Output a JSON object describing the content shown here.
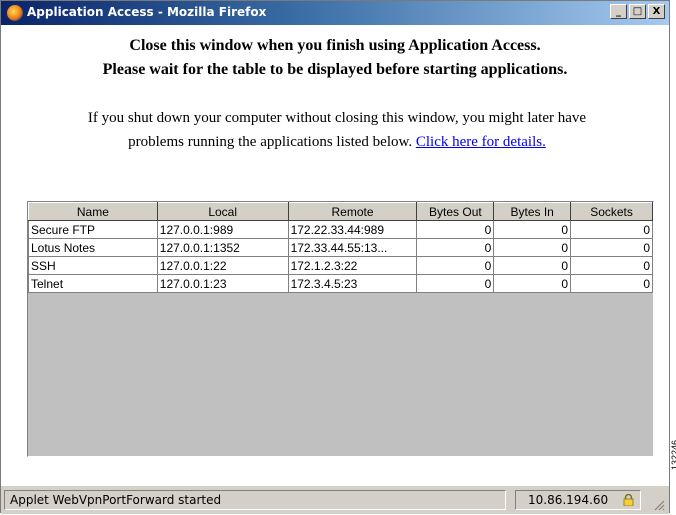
{
  "window": {
    "title": "Application Access - Mozilla Firefox",
    "buttons": {
      "minimize": "_",
      "maximize": "□",
      "close": "X"
    }
  },
  "content": {
    "heading_line1": "Close this window when you finish using Application Access.",
    "heading_line2": "Please wait for the table to be displayed before starting applications.",
    "paragraph_line1": "If you shut down your computer without closing this window, you might later have",
    "paragraph_line2": "problems running the applications listed below.",
    "link_text": "Click here for details."
  },
  "table": {
    "columns": [
      "Name",
      "Local",
      "Remote",
      "Bytes Out",
      "Bytes In",
      "Sockets"
    ],
    "rows": [
      [
        "Secure FTP",
        "127.0.0.1:989",
        "172.22.33.44:989",
        "0",
        "0",
        "0"
      ],
      [
        "Lotus Notes",
        "127.0.0.1:1352",
        "172.33.44.55:13...",
        "0",
        "0",
        "0"
      ],
      [
        "SSH",
        "127.0.0.1:22",
        "172.1.2.3:22",
        "0",
        "0",
        "0"
      ],
      [
        "Telnet",
        "127.0.0.1:23",
        "172.3.4.5:23",
        "0",
        "0",
        "0"
      ]
    ]
  },
  "statusbar": {
    "text": "Applet WebVpnPortForward started",
    "ip": "10.86.194.60"
  },
  "side_label": "132246",
  "colors": {
    "titlebar_start": "#0a246a",
    "link": "#0000ee",
    "chrome": "#d4d0c8"
  }
}
